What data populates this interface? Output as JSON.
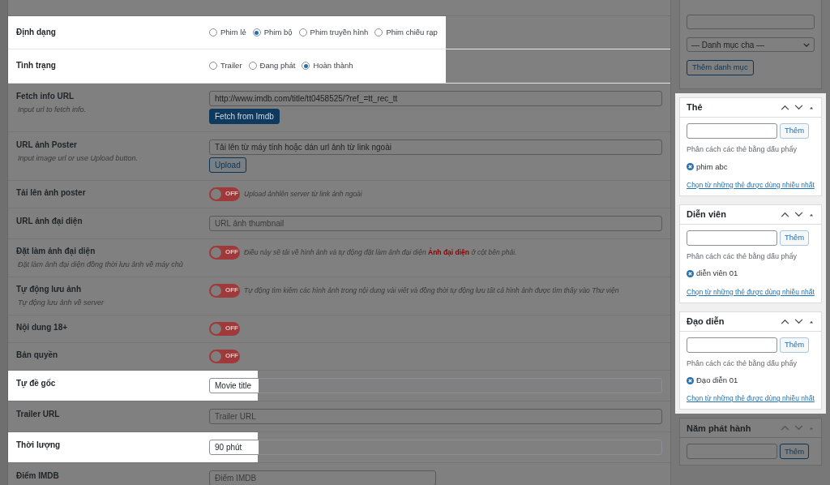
{
  "form_rows": [
    {
      "kind": "radio",
      "label": "Định dạng",
      "highlighted": true,
      "options": [
        {
          "label": "Phim lẻ",
          "selected": false
        },
        {
          "label": "Phim bộ",
          "selected": true
        },
        {
          "label": "Phim truyền hình",
          "selected": false
        },
        {
          "label": "Phim chiếu rạp",
          "selected": false
        }
      ]
    },
    {
      "kind": "radio",
      "label": "Tình trạng",
      "highlighted": true,
      "options": [
        {
          "label": "Trailer",
          "selected": false
        },
        {
          "label": "Đang phát",
          "selected": false
        },
        {
          "label": "Hoàn thành",
          "selected": true
        }
      ]
    },
    {
      "kind": "input",
      "label": "Fetch info URL",
      "description": "Input url to fetch info.",
      "highlighted": false,
      "value": "http://www.imdb.com/title/tt0458525/?ref_=tt_rec_tt",
      "button": {
        "label": "Fetch from Imdb",
        "kind": "primary"
      }
    },
    {
      "kind": "input",
      "label": "URL ảnh Poster",
      "description": "Input image url or use Upload button.",
      "highlighted": false,
      "value": "Tải lên từ máy tính hoặc dán url ảnh từ link ngoài",
      "button": {
        "label": "Upload",
        "kind": "secondary"
      }
    },
    {
      "kind": "toggle",
      "label": "Tải lên ảnh poster",
      "highlighted": false,
      "on": false,
      "switch_text": "OFF",
      "hint": "Upload ảnhlên server từ link ảnh ngoài"
    },
    {
      "kind": "input",
      "label": "URL ảnh đại diện",
      "highlighted": false,
      "placeholder": "URL ảnh thumbnail"
    },
    {
      "kind": "toggle",
      "label": "Đặt làm ảnh đại diện",
      "description": "Đặt làm ảnh đại diện đồng thời lưu ảnh về máy chủ",
      "highlighted": false,
      "on": false,
      "switch_text": "OFF",
      "hint": "Điều này sẽ tải về hình ảnh và tự động đặt làm ảnh đại diện **Ảnh đại diện** ở cột bên phải."
    },
    {
      "kind": "toggle",
      "label": "Tự động lưu ảnh",
      "description": "Tự động lưu ảnh về server",
      "highlighted": false,
      "on": false,
      "switch_text": "OFF",
      "hint": "Tự động tìm kiếm các hình ảnh trong nội dung vài viết và đồng thời tự động lưu tất cả hình ảnh được tìm thấy vào Thư viện"
    },
    {
      "kind": "toggle",
      "label": "Nội dung 18+",
      "highlighted": false,
      "on": false,
      "switch_text": "OFF"
    },
    {
      "kind": "toggle",
      "label": "Bản quyền",
      "highlighted": false,
      "on": false,
      "switch_text": "OFF"
    },
    {
      "kind": "input",
      "label": "Tự đề gốc",
      "highlighted": true,
      "value": "Movie title"
    },
    {
      "kind": "input",
      "label": "Trailer URL",
      "highlighted": false,
      "placeholder": "Trailer URL"
    },
    {
      "kind": "input",
      "label": "Thời lượng",
      "highlighted": true,
      "value": "90 phút"
    },
    {
      "kind": "input",
      "label": "Điểm IMDB",
      "highlighted": false,
      "placeholder": "Điểm IMDB",
      "narrow": true
    }
  ],
  "sidebar": {
    "category": {
      "parent_select": "— Danh mục cha —",
      "button": "Thêm danh mục"
    },
    "tag_boxes": [
      {
        "title": "Thẻ",
        "highlighted": true,
        "button": "Thêm",
        "hint": "Phân cách các thẻ bằng dấu phẩy",
        "tags": [
          "phim abc"
        ],
        "link": "Chọn từ những thẻ được dùng nhiều nhất"
      },
      {
        "title": "Diễn viên",
        "highlighted": true,
        "button": "Thêm",
        "hint": "Phân cách các thẻ bằng dấu phẩy",
        "tags": [
          "diễn viên 01"
        ],
        "link": "Chọn từ những thẻ được dùng nhiều nhất"
      },
      {
        "title": "Đạo diễn",
        "highlighted": true,
        "button": "Thêm",
        "hint": "Phân cách các thẻ bằng dấu phẩy",
        "tags": [
          "Đạo diễn 01"
        ],
        "link": "Chọn từ những thẻ được dùng nhiều nhất"
      },
      {
        "title": "Năm phát hành",
        "highlighted": false,
        "button": "Thêm"
      }
    ]
  }
}
